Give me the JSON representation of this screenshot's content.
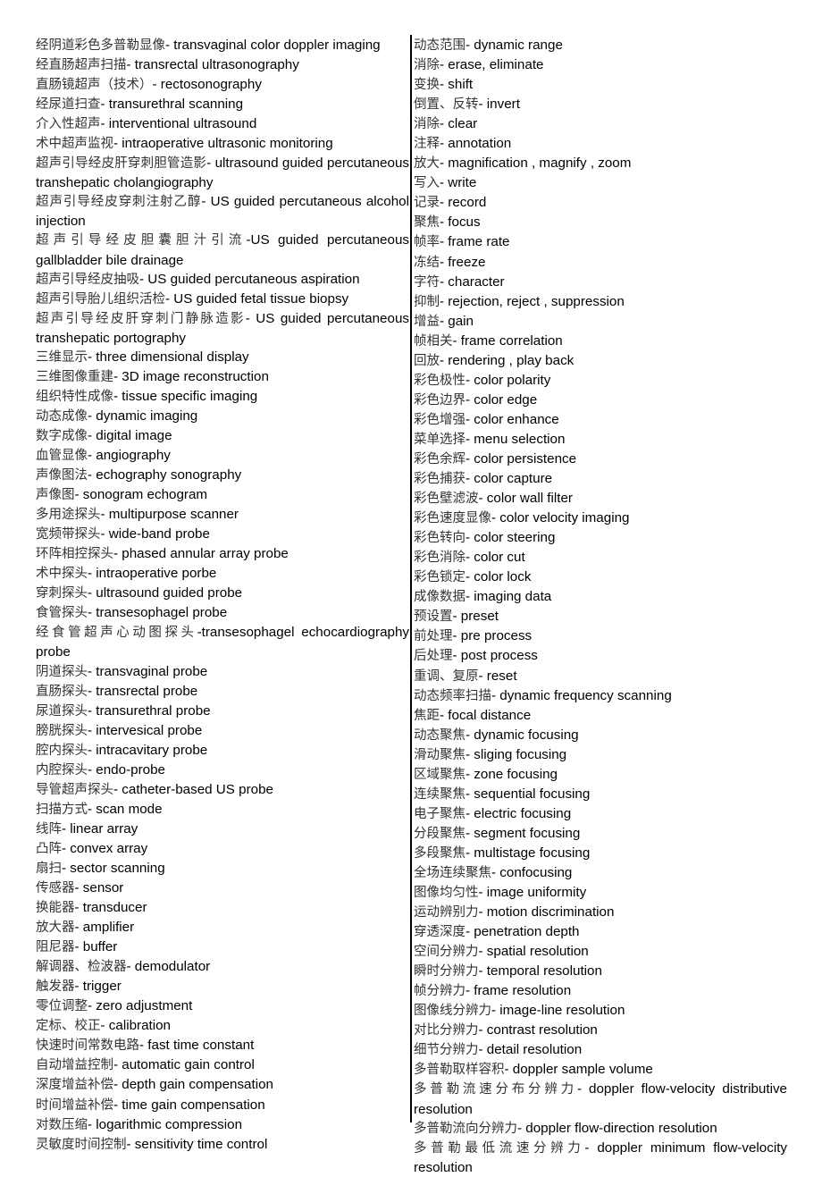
{
  "document": {
    "left_column": [
      {
        "zh": "经阴道彩色多普勒显像",
        "en": "- transvaginal color doppler imaging"
      },
      {
        "zh": "经直肠超声扫描",
        "en": "- transrectal ultrasonography"
      },
      {
        "zh": "直肠镜超声（技术）",
        "en": "- rectosonography"
      },
      {
        "zh": "经尿道扫查",
        "en": "- transurethral scanning"
      },
      {
        "zh": "介入性超声",
        "en": "- interventional ultrasound"
      },
      {
        "zh": "术中超声监视",
        "en": "- intraoperative ultrasonic monitoring"
      },
      {
        "zh": "超声引导经皮肝穿刺胆管造影",
        "en": "- ultrasound guided percutaneous transhepatic cholangiography"
      },
      {
        "zh": "超声引导经皮穿刺注射乙醇",
        "en": "- US guided percutaneous alcohol injection"
      },
      {
        "zh": "超声引导经皮胆囊胆汁引流",
        "en": "-US guided percutaneous gallbladder bile drainage"
      },
      {
        "zh": "超声引导经皮抽吸",
        "en": "- US guided percutaneous aspiration"
      },
      {
        "zh": "超声引导胎儿组织活检",
        "en": "- US guided fetal tissue biopsy"
      },
      {
        "zh": "超声引导经皮肝穿刺门静脉造影",
        "en": "- US guided percutaneous transhepatic portography"
      },
      {
        "zh": "三维显示",
        "en": "- three dimensional display"
      },
      {
        "zh": "三维图像重建",
        "en": "- 3D image reconstruction"
      },
      {
        "zh": "组织特性成像",
        "en": "- tissue specific imaging"
      },
      {
        "zh": "动态成像",
        "en": "- dynamic imaging"
      },
      {
        "zh": "数字成像",
        "en": "- digital image"
      },
      {
        "zh": "血管显像",
        "en": "- angiography"
      },
      {
        "zh": "声像图法",
        "en": "- echography sonography"
      },
      {
        "zh": "声像图",
        "en": "- sonogram echogram"
      },
      {
        "zh": "多用途探头",
        "en": "- multipurpose scanner"
      },
      {
        "zh": "宽频带探头",
        "en": "- wide-band probe"
      },
      {
        "zh": "环阵相控探头",
        "en": "- phased annular array probe"
      },
      {
        "zh": "术中探头",
        "en": "- intraoperative porbe"
      },
      {
        "zh": "穿刺探头",
        "en": "- ultrasound guided probe"
      },
      {
        "zh": "食管探头",
        "en": "- transesophagel probe"
      },
      {
        "zh": "经食管超声心动图探头",
        "en": "-transesophagel echocardiography probe"
      },
      {
        "zh": "阴道探头",
        "en": "- transvaginal probe"
      },
      {
        "zh": "直肠探头",
        "en": "- transrectal probe"
      },
      {
        "zh": "尿道探头",
        "en": "- transurethral probe"
      },
      {
        "zh": "膀胱探头",
        "en": "- intervesical probe"
      },
      {
        "zh": "腔内探头",
        "en": "- intracavitary probe"
      },
      {
        "zh": "内腔探头",
        "en": "- endo-probe"
      },
      {
        "zh": "导管超声探头",
        "en": "- catheter-based US probe"
      },
      {
        "zh": "扫描方式",
        "en": "- scan mode"
      },
      {
        "zh": "线阵",
        "en": "- linear array"
      },
      {
        "zh": "凸阵",
        "en": "- convex array"
      },
      {
        "zh": "扇扫",
        "en": "- sector scanning"
      },
      {
        "zh": "传感器",
        "en": "- sensor"
      },
      {
        "zh": "换能器",
        "en": "- transducer"
      },
      {
        "zh": "放大器",
        "en": "- amplifier"
      },
      {
        "zh": "阻尼器",
        "en": "- buffer"
      },
      {
        "zh": "解调器、检波器",
        "en": "- demodulator"
      },
      {
        "zh": "触发器",
        "en": "- trigger"
      },
      {
        "zh": "零位调整",
        "en": "- zero adjustment"
      },
      {
        "zh": "定标、校正",
        "en": "- calibration"
      },
      {
        "zh": "快速时间常数电路",
        "en": "- fast time constant"
      },
      {
        "zh": "自动增益控制",
        "en": "- automatic gain control"
      },
      {
        "zh": "深度增益补偿",
        "en": "- depth gain compensation"
      },
      {
        "zh": "时间增益补偿",
        "en": "- time gain compensation"
      },
      {
        "zh": "对数压缩",
        "en": "- logarithmic compression"
      },
      {
        "zh": "灵敏度时间控制",
        "en": "- sensitivity time control"
      }
    ],
    "right_column": [
      {
        "zh": "动态范围",
        "en": "- dynamic range"
      },
      {
        "zh": "消除",
        "en": "- erase, eliminate"
      },
      {
        "zh": "变换",
        "en": "- shift"
      },
      {
        "zh": "倒置、反转",
        "en": "- invert"
      },
      {
        "zh": "消除",
        "en": "- clear"
      },
      {
        "zh": "注释",
        "en": "- annotation"
      },
      {
        "zh": "放大",
        "en": "- magnification , magnify , zoom"
      },
      {
        "zh": "写入",
        "en": "- write"
      },
      {
        "zh": "记录",
        "en": "- record"
      },
      {
        "zh": "聚焦",
        "en": "- focus"
      },
      {
        "zh": "帧率",
        "en": "- frame rate"
      },
      {
        "zh": "冻结",
        "en": "- freeze"
      },
      {
        "zh": "字符",
        "en": "- character"
      },
      {
        "zh": "抑制",
        "en": "- rejection, reject , suppression"
      },
      {
        "zh": "增益",
        "en": "- gain"
      },
      {
        "zh": "帧相关",
        "en": "- frame correlation"
      },
      {
        "zh": "回放",
        "en": "- rendering , play back"
      },
      {
        "zh": "彩色极性",
        "en": "- color polarity"
      },
      {
        "zh": "彩色边界",
        "en": "- color edge"
      },
      {
        "zh": "彩色增强",
        "en": "- color enhance"
      },
      {
        "zh": "菜单选择",
        "en": "- menu selection"
      },
      {
        "zh": "彩色余辉",
        "en": "- color persistence"
      },
      {
        "zh": "彩色捕获",
        "en": "- color capture"
      },
      {
        "zh": "彩色壁滤波",
        "en": "- color wall filter"
      },
      {
        "zh": "彩色速度显像",
        "en": "- color velocity imaging"
      },
      {
        "zh": "彩色转向",
        "en": "- color steering"
      },
      {
        "zh": "彩色消除",
        "en": "- color cut"
      },
      {
        "zh": "彩色锁定",
        "en": "- color lock"
      },
      {
        "zh": "成像数据",
        "en": "- imaging data"
      },
      {
        "zh": "预设置",
        "en": "- preset"
      },
      {
        "zh": "前处理",
        "en": "- pre process"
      },
      {
        "zh": "后处理",
        "en": "- post process"
      },
      {
        "zh": "重调、复原",
        "en": "- reset"
      },
      {
        "zh": "动态频率扫描",
        "en": "- dynamic frequency scanning"
      },
      {
        "zh": "焦距",
        "en": "- focal distance"
      },
      {
        "zh": "动态聚焦",
        "en": "- dynamic focusing"
      },
      {
        "zh": "滑动聚焦",
        "en": "- sliging focusing"
      },
      {
        "zh": "区域聚焦",
        "en": "- zone focusing"
      },
      {
        "zh": "连续聚焦",
        "en": "- sequential focusing"
      },
      {
        "zh": "电子聚焦",
        "en": "- electric focusing"
      },
      {
        "zh": "分段聚焦",
        "en": "- segment focusing"
      },
      {
        "zh": "多段聚焦",
        "en": "- multistage focusing"
      },
      {
        "zh": "全场连续聚焦",
        "en": "- confocusing"
      },
      {
        "zh": "图像均匀性",
        "en": "- image uniformity"
      },
      {
        "zh": "运动辨别力",
        "en": "- motion discrimination"
      },
      {
        "zh": "穿透深度",
        "en": "- penetration depth"
      },
      {
        "zh": "空间分辨力",
        "en": "- spatial resolution"
      },
      {
        "zh": "瞬时分辨力",
        "en": "- temporal resolution"
      },
      {
        "zh": "帧分辨力",
        "en": "- frame resolution"
      },
      {
        "zh": "图像线分辨力",
        "en": "- image-line resolution"
      },
      {
        "zh": "对比分辨力",
        "en": "- contrast resolution"
      },
      {
        "zh": "细节分辨力",
        "en": "- detail resolution"
      },
      {
        "zh": "多普勒取样容积",
        "en": "- doppler sample volume"
      },
      {
        "zh": "多普勒流速分布分辨力",
        "en": "- doppler flow-velocity distributive resolution"
      },
      {
        "zh": "多普勒流向分辨力",
        "en": "- doppler flow-direction resolution"
      },
      {
        "zh": "多普勒最低流速分辨力",
        "en": "- doppler minimum flow-velocity resolution"
      }
    ]
  }
}
